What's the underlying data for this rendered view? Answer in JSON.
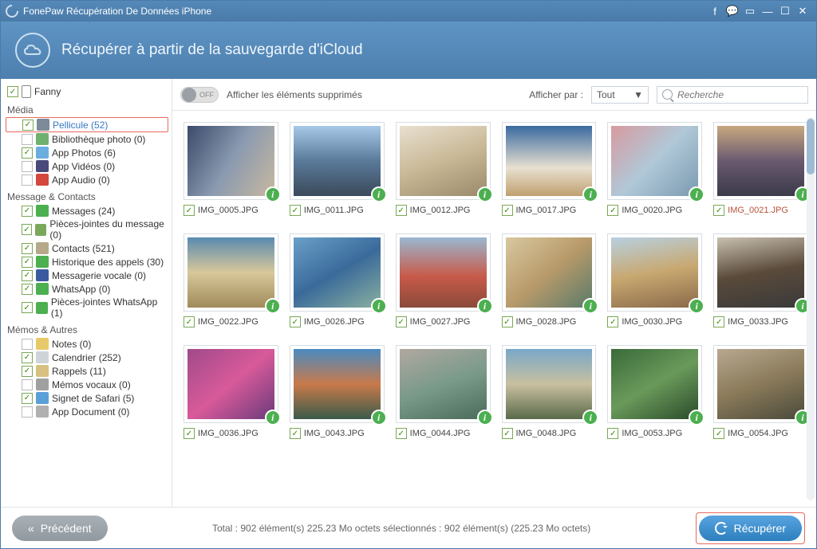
{
  "title": "FonePaw Récupération De Données iPhone",
  "header": "Récupérer à partir de la sauvegarde d'iCloud",
  "deviceName": "Fanny",
  "sections": {
    "media": {
      "label": "Média",
      "items": [
        {
          "label": "Pellicule (52)",
          "checked": true,
          "selected": true,
          "color": "#7c8a99"
        },
        {
          "label": "Bibliothèque photo (0)",
          "checked": false,
          "color": "#6fb06f"
        },
        {
          "label": "App Photos (6)",
          "checked": true,
          "color": "#6aaee0"
        },
        {
          "label": "App Vidéos (0)",
          "checked": false,
          "color": "#4a4a7a"
        },
        {
          "label": "App Audio (0)",
          "checked": false,
          "color": "#d4473c"
        }
      ]
    },
    "msg": {
      "label": "Message & Contacts",
      "items": [
        {
          "label": "Messages (24)",
          "checked": true,
          "color": "#4caf50"
        },
        {
          "label": "Pièces-jointes du message (0)",
          "checked": true,
          "color": "#7aa85a"
        },
        {
          "label": "Contacts (521)",
          "checked": true,
          "color": "#b5a98a"
        },
        {
          "label": "Historique des appels (30)",
          "checked": true,
          "color": "#4caf50"
        },
        {
          "label": "Messagerie vocale (0)",
          "checked": true,
          "color": "#3a5aa0"
        },
        {
          "label": "WhatsApp (0)",
          "checked": true,
          "color": "#4caf50"
        },
        {
          "label": "Pièces-jointes WhatsApp (1)",
          "checked": true,
          "color": "#4caf50"
        }
      ]
    },
    "memo": {
      "label": "Mémos & Autres",
      "items": [
        {
          "label": "Notes (0)",
          "checked": false,
          "color": "#e8c96a"
        },
        {
          "label": "Calendrier (252)",
          "checked": true,
          "color": "#cfd4d8"
        },
        {
          "label": "Rappels (11)",
          "checked": true,
          "color": "#d8c080"
        },
        {
          "label": "Mémos vocaux (0)",
          "checked": false,
          "color": "#a0a0a0"
        },
        {
          "label": "Signet de Safari (5)",
          "checked": true,
          "color": "#5aa0d8"
        },
        {
          "label": "App Document (0)",
          "checked": false,
          "color": "#b0b0b0"
        }
      ]
    }
  },
  "toolbar": {
    "toggleLabel": "OFF",
    "toggleText": "Afficher les éléments supprimés",
    "displayBy": "Afficher par :",
    "displayValue": "Tout",
    "searchPlaceholder": "Recherche"
  },
  "thumbs": [
    {
      "name": "IMG_0005.JPG",
      "bg": "linear-gradient(120deg,#3a4a6a,#8a9ab0,#c8b8a0)"
    },
    {
      "name": "IMG_0011.JPG",
      "bg": "linear-gradient(180deg,#a8c8e8,#5a7a9a,#3a4a5a)"
    },
    {
      "name": "IMG_0012.JPG",
      "bg": "linear-gradient(160deg,#e8e0d0,#c9b896,#9a8a6a)"
    },
    {
      "name": "IMG_0017.JPG",
      "bg": "linear-gradient(180deg,#3a6aa0,#e8e0d0 60%,#c0a070)"
    },
    {
      "name": "IMG_0020.JPG",
      "bg": "linear-gradient(135deg,#d89aa0,#b0c8d8,#7a9ab0)"
    },
    {
      "name": "IMG_0021.JPG",
      "bg": "linear-gradient(180deg,#c8a880,#6a5a70,#3a3a4a)",
      "deleted": true
    },
    {
      "name": "IMG_0022.JPG",
      "bg": "linear-gradient(180deg,#5a8ab0,#d8c89a,#a08a5a)"
    },
    {
      "name": "IMG_0026.JPG",
      "bg": "linear-gradient(150deg,#6aa0c8,#3a6a9a,#8ab0a0)"
    },
    {
      "name": "IMG_0027.JPG",
      "bg": "linear-gradient(180deg,#9ab8d0,#c85a4a 55%,#8a4a3a)"
    },
    {
      "name": "IMG_0028.JPG",
      "bg": "linear-gradient(140deg,#d8c8a0,#b89a6a,#5a7a6a)"
    },
    {
      "name": "IMG_0030.JPG",
      "bg": "linear-gradient(170deg,#b8d0e0,#c8a870,#8a6a4a)"
    },
    {
      "name": "IMG_0033.JPG",
      "bg": "linear-gradient(170deg,#c8c0b0,#5a4a3a,#3a3a3a)"
    },
    {
      "name": "IMG_0036.JPG",
      "bg": "linear-gradient(140deg,#a04a8a,#d85a9a,#6a3a7a)"
    },
    {
      "name": "IMG_0043.JPG",
      "bg": "linear-gradient(180deg,#4a8ac0,#c87a4a,#3a5a4a)"
    },
    {
      "name": "IMG_0044.JPG",
      "bg": "linear-gradient(160deg,#b0a8a0,#7a9a8a,#4a6a5a)"
    },
    {
      "name": "IMG_0048.JPG",
      "bg": "linear-gradient(180deg,#7aa8c8,#c8c0a0,#5a6a4a)"
    },
    {
      "name": "IMG_0053.JPG",
      "bg": "linear-gradient(150deg,#3a6a3a,#6a9a5a,#2a4a2a)"
    },
    {
      "name": "IMG_0054.JPG",
      "bg": "linear-gradient(160deg,#b8a890,#8a7a5a,#4a4a3a)"
    }
  ],
  "footer": {
    "prev": "Précédent",
    "status": "Total : 902 élément(s) 225.23 Mo octets sélectionnés : 902 élément(s) (225.23 Mo octets)",
    "recover": "Récupérer"
  }
}
